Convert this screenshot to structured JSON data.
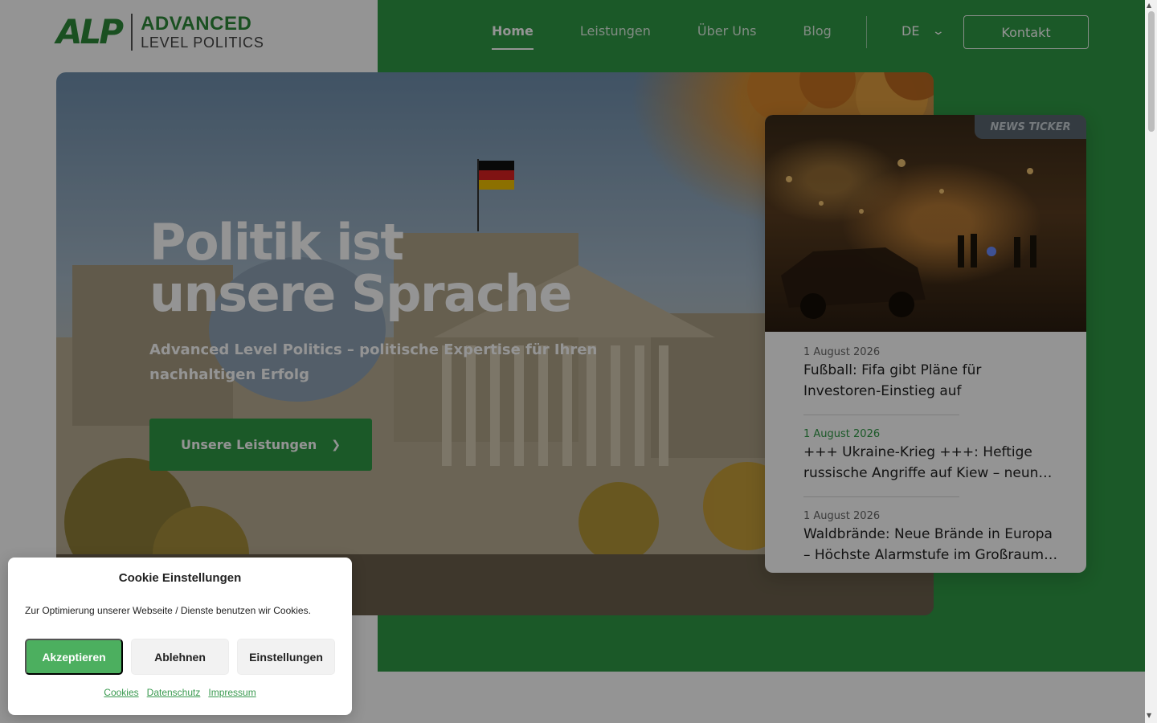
{
  "brand": {
    "logo_mark": "ALP",
    "line1": "ADVANCED",
    "line2": "LEVEL POLITICS"
  },
  "nav": {
    "items": [
      {
        "label": "Home",
        "active": true
      },
      {
        "label": "Leistungen",
        "active": false
      },
      {
        "label": "Über Uns",
        "active": false
      },
      {
        "label": "Blog",
        "active": false
      }
    ],
    "language": "DE",
    "contact_label": "Kontakt"
  },
  "hero": {
    "title_line1": "Politik ist",
    "title_line2": "unsere Sprache",
    "subtitle": "Advanced Level Politics – politische Expertise für Ihren nachhaltigen Erfolg",
    "cta_label": "Unsere Leistungen"
  },
  "ticker": {
    "tag": "NEWS TICKER",
    "items": [
      {
        "date": "1 August 2026",
        "title": "Fußball: Fifa gibt Pläne für Investoren-Einstieg auf",
        "highlight": false
      },
      {
        "date": "1 August 2026",
        "title": "+++ Ukraine-Krieg +++: Heftige russische Angriffe auf Kiew – neun…",
        "highlight": true
      },
      {
        "date": "1 August 2026",
        "title": "Waldbrände: Neue Brände in Europa – Höchste Alarmstufe im Großraum…",
        "highlight": false
      }
    ]
  },
  "cookie": {
    "title": "Cookie Einstellungen",
    "text": "Zur Optimierung unserer Webseite / Dienste benutzen wir Cookies.",
    "accept_label": "Akzeptieren",
    "deny_label": "Ablehnen",
    "settings_label": "Einstellungen",
    "links": [
      "Cookies",
      "Datenschutz",
      "Impressum"
    ]
  },
  "colors": {
    "brand_green": "#2f9a45",
    "accept_green": "#4caf5f"
  }
}
